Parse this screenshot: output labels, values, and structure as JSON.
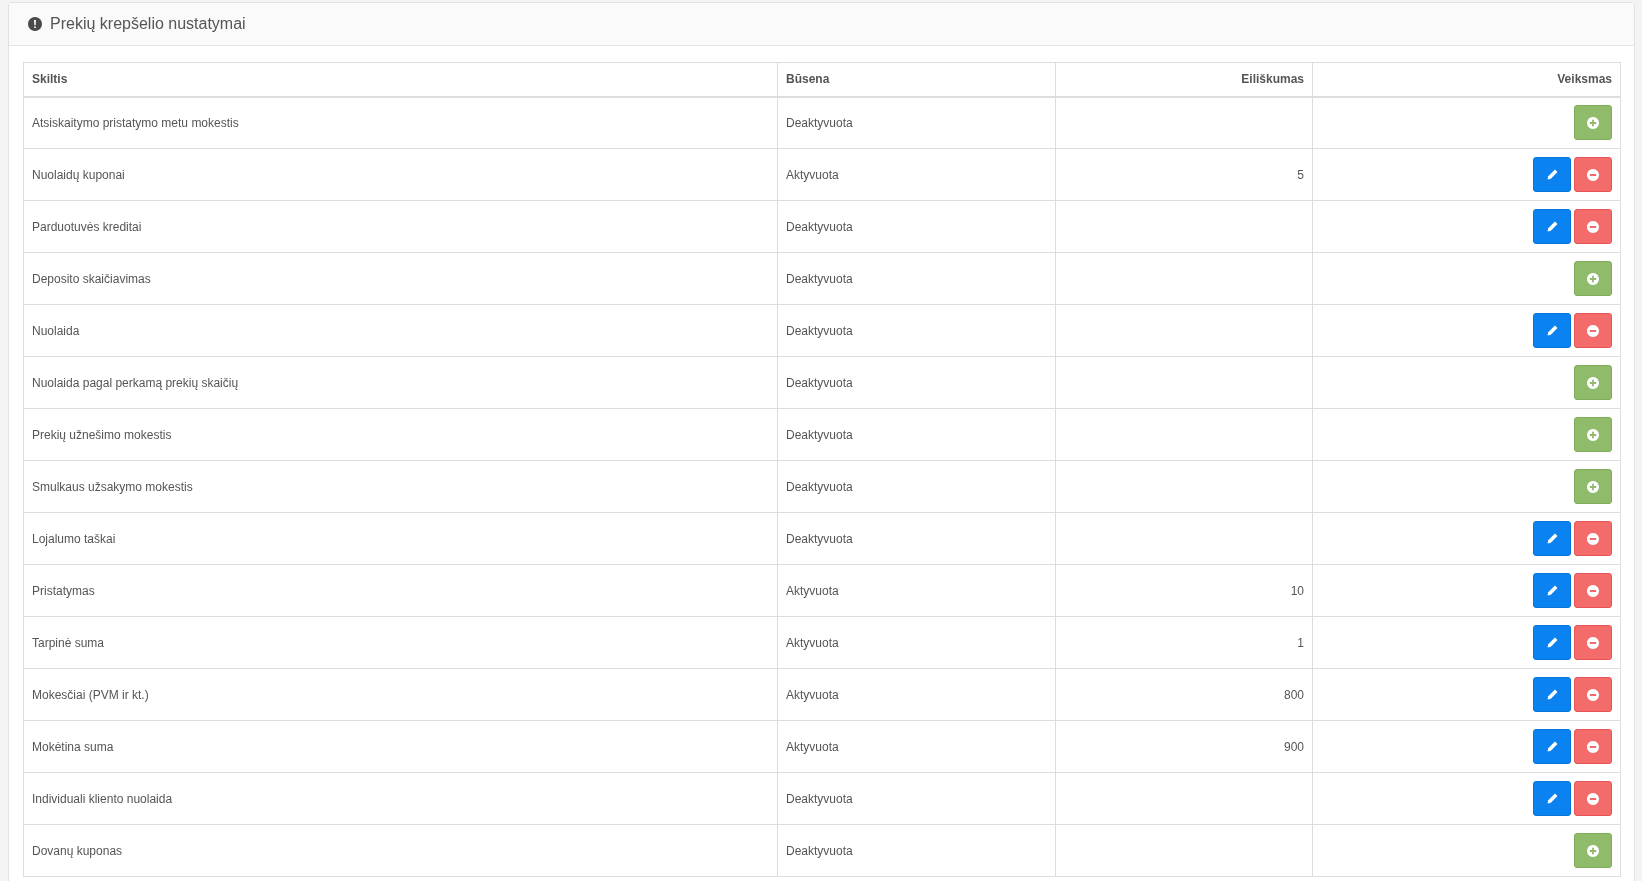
{
  "panel": {
    "title": "Prekių krepšelio nustatymai"
  },
  "table": {
    "columns": [
      "Skiltis",
      "Būsena",
      "Eiliškumas",
      "Veiksmas"
    ],
    "rows": [
      {
        "name": "Atsiskaitymo pristatymo metu mokestis",
        "status": "Deaktyvuota",
        "actions": [
          {
            "kind": "add"
          }
        ]
      },
      {
        "name": "Nuolaidų kuponai",
        "status": "Aktyvuota",
        "order": "5",
        "actions": [
          {
            "kind": "edit"
          },
          {
            "kind": "remove"
          }
        ]
      },
      {
        "name": "Parduotuvės kreditai",
        "status": "Deaktyvuota",
        "actions": [
          {
            "kind": "edit"
          },
          {
            "kind": "remove"
          }
        ]
      },
      {
        "name": "Deposito skaičiavimas",
        "status": "Deaktyvuota",
        "actions": [
          {
            "kind": "add"
          }
        ]
      },
      {
        "name": "Nuolaida",
        "status": "Deaktyvuota",
        "actions": [
          {
            "kind": "edit"
          },
          {
            "kind": "remove"
          }
        ]
      },
      {
        "name": "Nuolaida pagal perkamą prekių skaičių",
        "status": "Deaktyvuota",
        "actions": [
          {
            "kind": "add"
          }
        ]
      },
      {
        "name": "Prekių užnešimo mokestis",
        "status": "Deaktyvuota",
        "actions": [
          {
            "kind": "add"
          }
        ]
      },
      {
        "name": "Smulkaus užsakymo mokestis",
        "status": "Deaktyvuota",
        "actions": [
          {
            "kind": "add"
          }
        ]
      },
      {
        "name": "Lojalumo taškai",
        "status": "Deaktyvuota",
        "actions": [
          {
            "kind": "edit"
          },
          {
            "kind": "remove"
          }
        ]
      },
      {
        "name": "Pristatymas",
        "status": "Aktyvuota",
        "order": "10",
        "actions": [
          {
            "kind": "edit"
          },
          {
            "kind": "remove"
          }
        ]
      },
      {
        "name": "Tarpinė suma",
        "status": "Aktyvuota",
        "order": "1",
        "actions": [
          {
            "kind": "edit"
          },
          {
            "kind": "remove"
          }
        ]
      },
      {
        "name": "Mokesčiai (PVM ir kt.)",
        "status": "Aktyvuota",
        "order": "800",
        "actions": [
          {
            "kind": "edit"
          },
          {
            "kind": "remove"
          }
        ]
      },
      {
        "name": "Mokėtina suma",
        "status": "Aktyvuota",
        "order": "900",
        "actions": [
          {
            "kind": "edit"
          },
          {
            "kind": "remove"
          }
        ]
      },
      {
        "name": "Individuali kliento nuolaida",
        "status": "Deaktyvuota",
        "actions": [
          {
            "kind": "edit"
          },
          {
            "kind": "remove"
          }
        ]
      },
      {
        "name": "Dovanų kuponas",
        "status": "Deaktyvuota",
        "actions": [
          {
            "kind": "add"
          }
        ]
      }
    ]
  }
}
